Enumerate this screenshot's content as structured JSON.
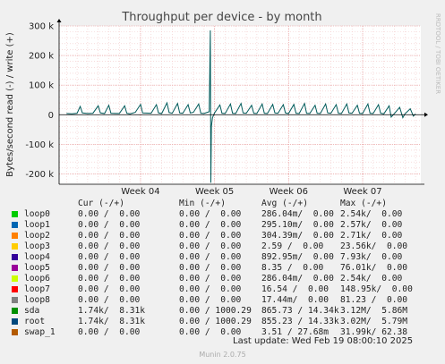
{
  "chart_data": {
    "type": "line",
    "title": "Throughput per device - by month",
    "ylabel": "Bytes/second read (-) / write (+)",
    "side_label": "RRDTOOL / TOBI OETIKER",
    "yticks": [
      {
        "value": 300000,
        "label": "300 k"
      },
      {
        "value": 200000,
        "label": "200 k"
      },
      {
        "value": 100000,
        "label": "100 k"
      },
      {
        "value": 0,
        "label": "0"
      },
      {
        "value": -100000,
        "label": "-100 k"
      },
      {
        "value": -200000,
        "label": "-200 k"
      }
    ],
    "ylim": [
      -235000,
      300000
    ],
    "xticks": [
      {
        "day": 7,
        "label": "Week 04"
      },
      {
        "day": 14,
        "label": "Week 05"
      },
      {
        "day": 21,
        "label": "Week 06"
      },
      {
        "day": 28,
        "label": "Week 07"
      }
    ],
    "xlim": [
      -0.7,
      33.5
    ],
    "grid": true,
    "series": [
      {
        "name": "root",
        "color": "#005a5a",
        "points": [
          [
            0,
            4000
          ],
          [
            0.5,
            3000
          ],
          [
            1,
            5000
          ],
          [
            1.3,
            28000
          ],
          [
            1.5,
            6000
          ],
          [
            2,
            4000
          ],
          [
            2.5,
            5000
          ],
          [
            3,
            30000
          ],
          [
            3.2,
            6000
          ],
          [
            3.6,
            4000
          ],
          [
            4,
            32000
          ],
          [
            4.2,
            5000
          ],
          [
            5,
            4000
          ],
          [
            5.5,
            30000
          ],
          [
            5.7,
            5000
          ],
          [
            6,
            3000
          ],
          [
            6.5,
            8000
          ],
          [
            7,
            35000
          ],
          [
            7.2,
            6000
          ],
          [
            8,
            5000
          ],
          [
            8.5,
            34000
          ],
          [
            8.7,
            6000
          ],
          [
            9,
            4000
          ],
          [
            9.5,
            40000
          ],
          [
            9.7,
            7000
          ],
          [
            10,
            5000
          ],
          [
            10.5,
            38000
          ],
          [
            10.7,
            6000
          ],
          [
            11,
            5000
          ],
          [
            11.5,
            34000
          ],
          [
            11.7,
            6000
          ],
          [
            12,
            8000
          ],
          [
            12.5,
            36000
          ],
          [
            12.7,
            5000
          ],
          [
            13,
            4000
          ],
          [
            13.5,
            10000
          ],
          [
            13.6,
            285000
          ],
          [
            13.65,
            -230000
          ],
          [
            13.7,
            -40000
          ],
          [
            13.8,
            -10000
          ],
          [
            14,
            6000
          ],
          [
            14.5,
            33000
          ],
          [
            14.7,
            5000
          ],
          [
            15,
            4000
          ],
          [
            15.5,
            36000
          ],
          [
            15.7,
            5000
          ],
          [
            16,
            4000
          ],
          [
            16.5,
            38000
          ],
          [
            16.7,
            6000
          ],
          [
            17,
            5000
          ],
          [
            17.5,
            32000
          ],
          [
            17.7,
            5000
          ],
          [
            18,
            4000
          ],
          [
            18.5,
            36000
          ],
          [
            18.7,
            5000
          ],
          [
            19,
            4000
          ],
          [
            19.5,
            35000
          ],
          [
            19.7,
            6000
          ],
          [
            20,
            5000
          ],
          [
            20.5,
            34000
          ],
          [
            20.7,
            6000
          ],
          [
            21,
            4000
          ],
          [
            21.5,
            35000
          ],
          [
            21.7,
            5000
          ],
          [
            22,
            4000
          ],
          [
            22.5,
            38000
          ],
          [
            22.7,
            5000
          ],
          [
            23,
            4000
          ],
          [
            23.5,
            32000
          ],
          [
            23.7,
            5000
          ],
          [
            24,
            4000
          ],
          [
            24.5,
            36000
          ],
          [
            24.7,
            6000
          ],
          [
            25,
            5000
          ],
          [
            25.5,
            34000
          ],
          [
            25.7,
            5000
          ],
          [
            26,
            4000
          ],
          [
            26.5,
            36000
          ],
          [
            26.7,
            6000
          ],
          [
            27,
            5000
          ],
          [
            27.5,
            32000
          ],
          [
            27.7,
            5000
          ],
          [
            28,
            4000
          ],
          [
            28.5,
            36000
          ],
          [
            28.7,
            5000
          ],
          [
            29,
            4000
          ],
          [
            29.5,
            34000
          ],
          [
            29.7,
            5000
          ],
          [
            30,
            3000
          ],
          [
            30.5,
            30000
          ],
          [
            30.7,
            -8000
          ],
          [
            31,
            4000
          ],
          [
            31.5,
            25000
          ],
          [
            31.8,
            -10000
          ],
          [
            32,
            3000
          ],
          [
            32.5,
            20000
          ],
          [
            32.8,
            -5000
          ],
          [
            33,
            3000
          ]
        ]
      }
    ]
  },
  "legend": {
    "header": {
      "cur": "Cur (-/+)",
      "min": "Min (-/+)",
      "avg": "Avg (-/+)",
      "max": "Max (-/+)"
    },
    "rows": [
      {
        "name": "loop0",
        "color": "#00cc00",
        "cur": "0.00 /  0.00",
        "min": "0.00 /  0.00",
        "avg": "286.04m/  0.00",
        "max": "2.54k/  0.00"
      },
      {
        "name": "loop1",
        "color": "#0066b3",
        "cur": "0.00 /  0.00",
        "min": "0.00 /  0.00",
        "avg": "295.10m/  0.00",
        "max": "2.57k/  0.00"
      },
      {
        "name": "loop2",
        "color": "#ff8000",
        "cur": "0.00 /  0.00",
        "min": "0.00 /  0.00",
        "avg": "304.39m/  0.00",
        "max": "2.71k/  0.00"
      },
      {
        "name": "loop3",
        "color": "#ffcc00",
        "cur": "0.00 /  0.00",
        "min": "0.00 /  0.00",
        "avg": "2.59 /  0.00",
        "max": "23.56k/  0.00"
      },
      {
        "name": "loop4",
        "color": "#330099",
        "cur": "0.00 /  0.00",
        "min": "0.00 /  0.00",
        "avg": "892.95m/  0.00",
        "max": "7.93k/  0.00"
      },
      {
        "name": "loop5",
        "color": "#990099",
        "cur": "0.00 /  0.00",
        "min": "0.00 /  0.00",
        "avg": "8.35 /  0.00",
        "max": "76.01k/  0.00"
      },
      {
        "name": "loop6",
        "color": "#ccff00",
        "cur": "0.00 /  0.00",
        "min": "0.00 /  0.00",
        "avg": "286.04m/  0.00",
        "max": "2.54k/  0.00"
      },
      {
        "name": "loop7",
        "color": "#ff0000",
        "cur": "0.00 /  0.00",
        "min": "0.00 /  0.00",
        "avg": "16.54 /  0.00",
        "max": "148.95k/  0.00"
      },
      {
        "name": "loop8",
        "color": "#808080",
        "cur": "0.00 /  0.00",
        "min": "0.00 /  0.00",
        "avg": "17.44m/  0.00",
        "max": "81.23 /  0.00"
      },
      {
        "name": "sda",
        "color": "#008f00",
        "cur": "1.74k/  8.31k",
        "min": "0.00 / 1000.29",
        "avg": "865.73 / 14.34k",
        "max": "3.12M/  5.86M"
      },
      {
        "name": "root",
        "color": "#00487d",
        "cur": "1.74k/  8.31k",
        "min": "0.00 / 1000.29",
        "avg": "855.23 / 14.33k",
        "max": "3.02M/  5.79M"
      },
      {
        "name": "swap_1",
        "color": "#b35a00",
        "cur": "0.00 /  0.00",
        "min": "0.00 /  0.00",
        "avg": "3.51 / 27.68m",
        "max": "31.99k/ 62.38"
      }
    ]
  },
  "last_update": "Last update: Wed Feb 19 08:00:10 2025",
  "footer": "Munin 2.0.75"
}
